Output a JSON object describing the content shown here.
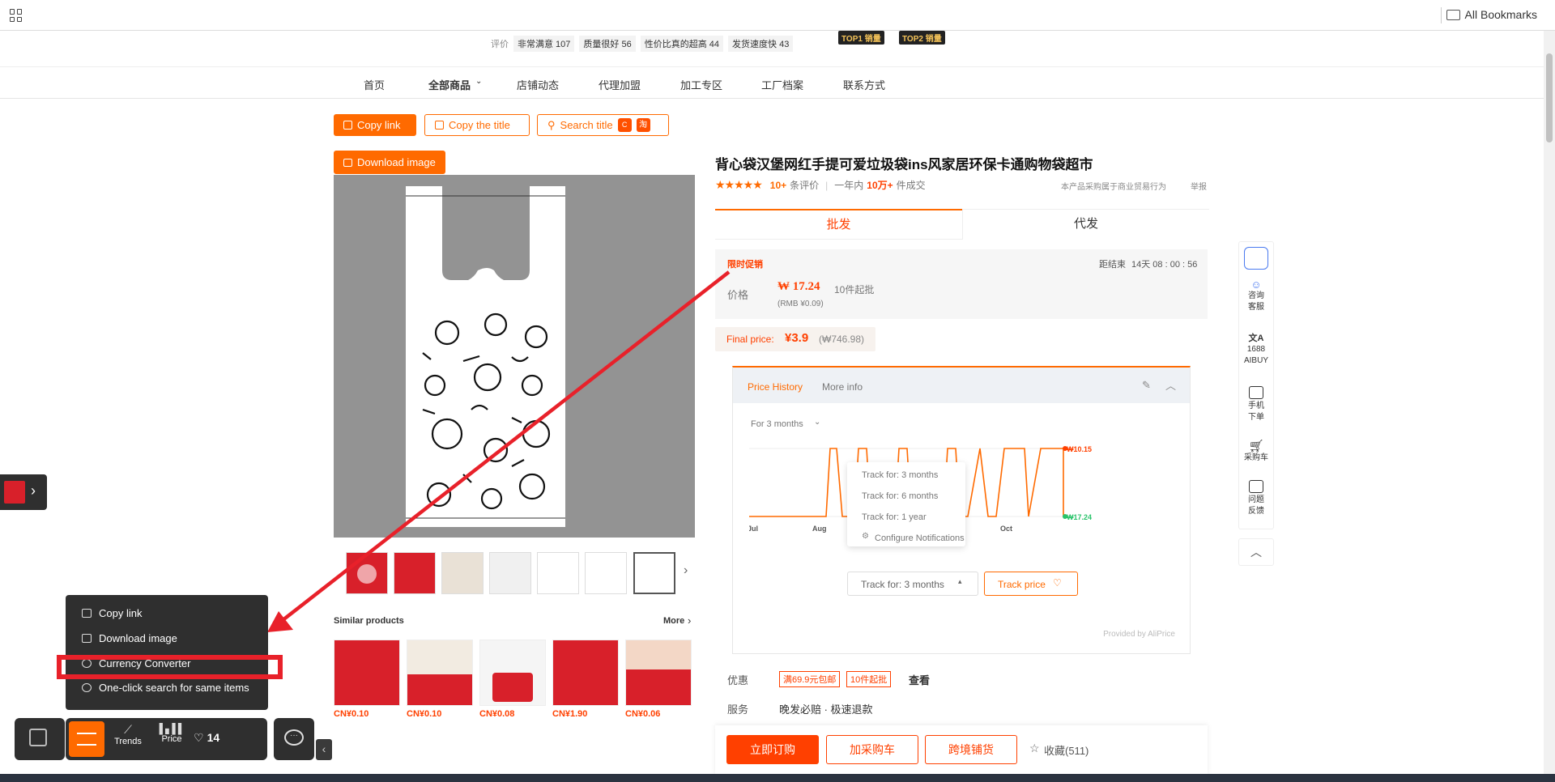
{
  "browser": {
    "all_bookmarks": "All Bookmarks"
  },
  "store": {
    "review_label": "评价",
    "reviews": [
      "非常满意 107",
      "质量很好 56",
      "性价比真的超高 44",
      "发货速度快 43"
    ],
    "badges": [
      "TOP1 销量",
      "TOP2 销量"
    ]
  },
  "nav": [
    "首页",
    "全部商品",
    "店铺动态",
    "代理加盟",
    "加工专区",
    "工厂档案",
    "联系方式"
  ],
  "actions": {
    "copy_link": "Copy link",
    "copy_title": "Copy the title",
    "search_title": "Search title",
    "download_image": "Download image",
    "taobao": "淘"
  },
  "product": {
    "title": "背心袋汉堡网红手提可爱垃圾袋ins风家居环保卡通购物袋超市",
    "rating_count": "10+",
    "rating_label": "条评价",
    "sold_prefix": "一年内",
    "sold": "10万+",
    "sold_suffix": "件成交",
    "notice": "本产品采购属于商业贸易行为",
    "report": "举报",
    "tab_wholesale": "批发",
    "tab_dropship": "代发",
    "promo_label": "限时促销",
    "countdown_label": "距结束",
    "countdown": "14天 08 : 00 : 56",
    "price_label": "价格",
    "price": "₩ 17.24",
    "moq": "10件起批",
    "rmb": "(RMB ¥0.09)",
    "final_label": "Final price:",
    "final_price": "¥3.9",
    "final_krw": "(₩746.98)"
  },
  "price_history": {
    "tab1": "Price History",
    "tab2": "More info",
    "range": "For 3 months",
    "max_label": "₩10.15",
    "min_label": "₩17.24",
    "x_ticks": [
      "Jul",
      "Aug",
      "Oct"
    ],
    "dropdown": [
      "Track for: 3 months",
      "Track for: 6 months",
      "Track for: 1 year",
      "Configure Notifications"
    ],
    "select_value": "Track for: 3 months",
    "track_button": "Track price",
    "provided": "Provided by AliPrice"
  },
  "offers": {
    "label": "优惠",
    "tags": [
      "满69.9元包邮",
      "10件起批"
    ],
    "view": "查看"
  },
  "service": {
    "label": "服务",
    "value": "晚发必赔 · 极速退款"
  },
  "bottom": {
    "buy": "立即订购",
    "cart": "加采购车",
    "cross": "跨境铺货",
    "fav": "收藏(511)"
  },
  "right_sidebar": [
    "咨询客服",
    "1688 AIBUY",
    "手机下单",
    "采购车",
    "问题反馈"
  ],
  "similar": {
    "title": "Similar products",
    "more": "More",
    "prices": [
      "CN¥0.10",
      "CN¥0.10",
      "CN¥0.08",
      "CN¥1.90",
      "CN¥0.06"
    ]
  },
  "context_menu": [
    "Copy link",
    "Download image",
    "Currency Converter",
    "One-click search for same items"
  ],
  "toolbar": {
    "trends": "Trends",
    "price": "Price",
    "likes": "14"
  },
  "colors": {
    "accent": "#ff6a00",
    "highlight": "#e8212a",
    "dark": "#2f2f2f"
  }
}
